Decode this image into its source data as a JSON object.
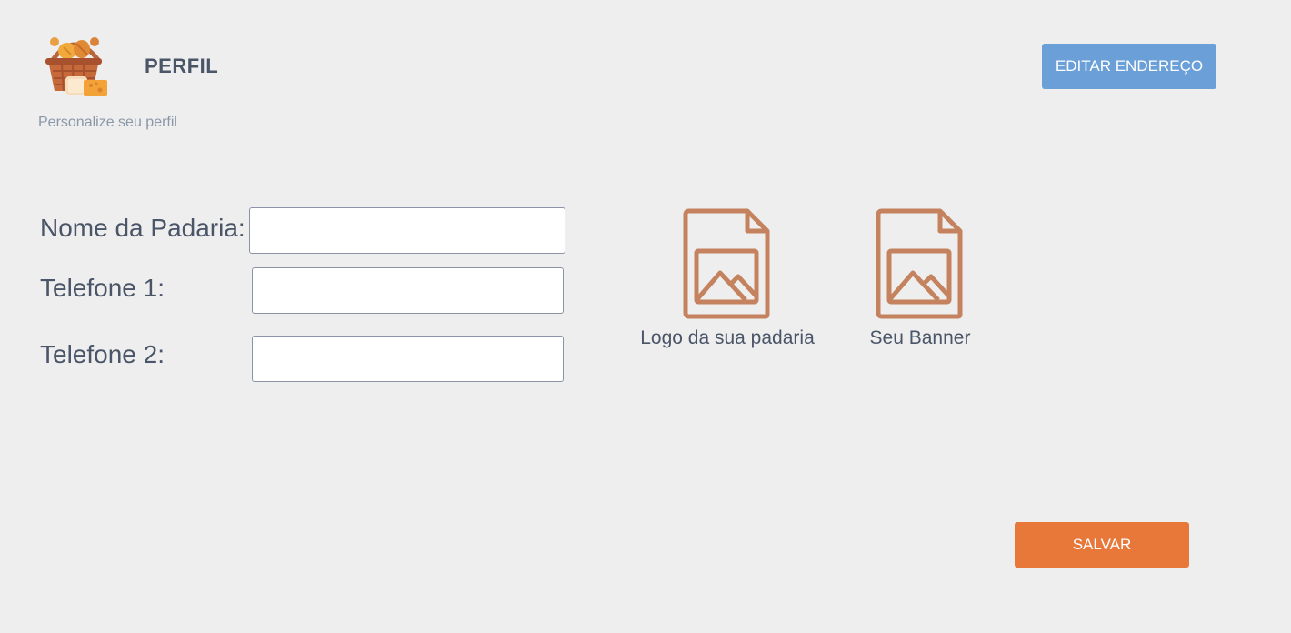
{
  "header": {
    "title": "PERFIL",
    "subtitle": "Personalize seu perfil",
    "logo_icon": "bread-basket-icon",
    "edit_address_label": "EDITAR ENDEREÇO"
  },
  "form": {
    "fields": [
      {
        "label": "Nome da Padaria:",
        "value": ""
      },
      {
        "label": "Telefone 1:",
        "value": ""
      },
      {
        "label": "Telefone 2:",
        "value": ""
      }
    ],
    "uploads": [
      {
        "label": "Logo da sua padaria",
        "icon": "image-file-icon"
      },
      {
        "label": "Seu Banner",
        "icon": "image-file-icon"
      }
    ],
    "save_label": "SALVAR"
  },
  "colors": {
    "background": "#eeeeee",
    "primary_button": "#6a9fd8",
    "save_button": "#e8783a",
    "upload_icon": "#c4825f",
    "text": "#4a5568"
  }
}
